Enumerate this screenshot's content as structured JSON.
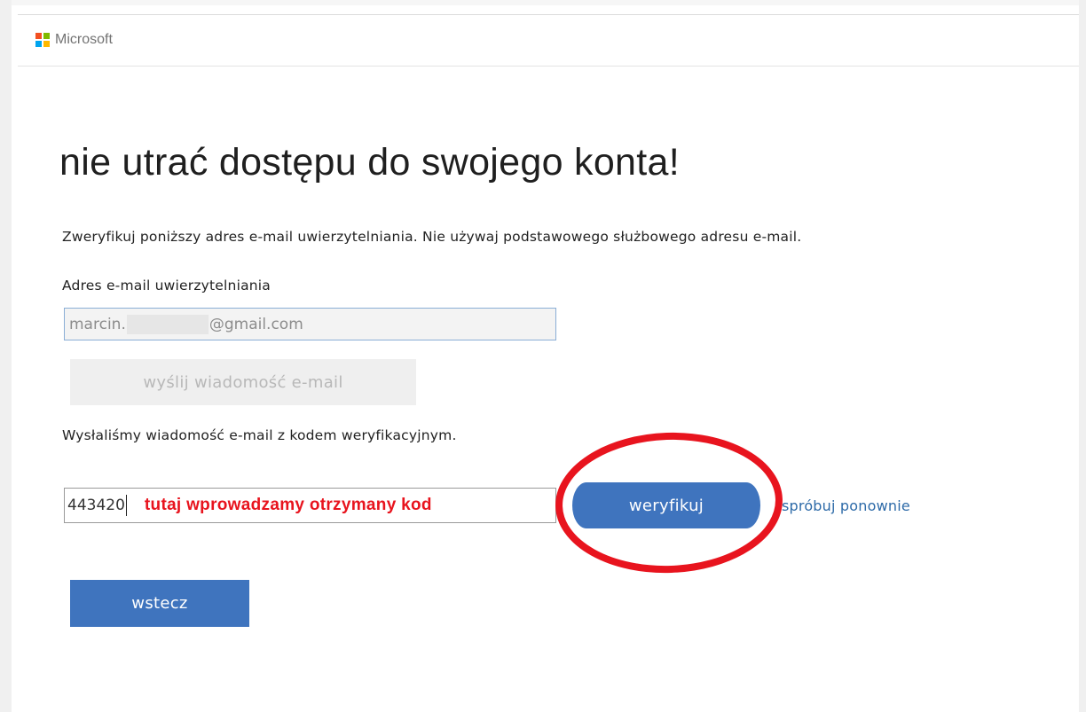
{
  "brand": {
    "name": "Microsoft",
    "logo_colors": [
      "#f25022",
      "#7fba00",
      "#00a4ef",
      "#ffb900"
    ]
  },
  "page": {
    "title": "nie utrać dostępu do swojego konta!",
    "description": "Zweryfikuj poniższy adres e-mail uwierzytelniania. Nie używaj podstawowego służbowego adresu e-mail."
  },
  "email": {
    "label": "Adres e-mail uwierzytelniania",
    "value_prefix": "marcin.",
    "value_suffix": "@gmail.com"
  },
  "buttons": {
    "send_email": "wyślij wiadomość e-mail",
    "verify": "weryfikuj",
    "retry": "spróbuj ponownie",
    "back": "wstecz"
  },
  "verification": {
    "sent_message": "Wysłaliśmy wiadomość e-mail z kodem weryfikacyjnym.",
    "code_value": "443420",
    "annotation": "tutaj wprowadzamy otrzymany kod"
  },
  "colors": {
    "primary_button": "#3f74be",
    "link": "#2d6aa8",
    "annotation_red": "#e8141e"
  }
}
